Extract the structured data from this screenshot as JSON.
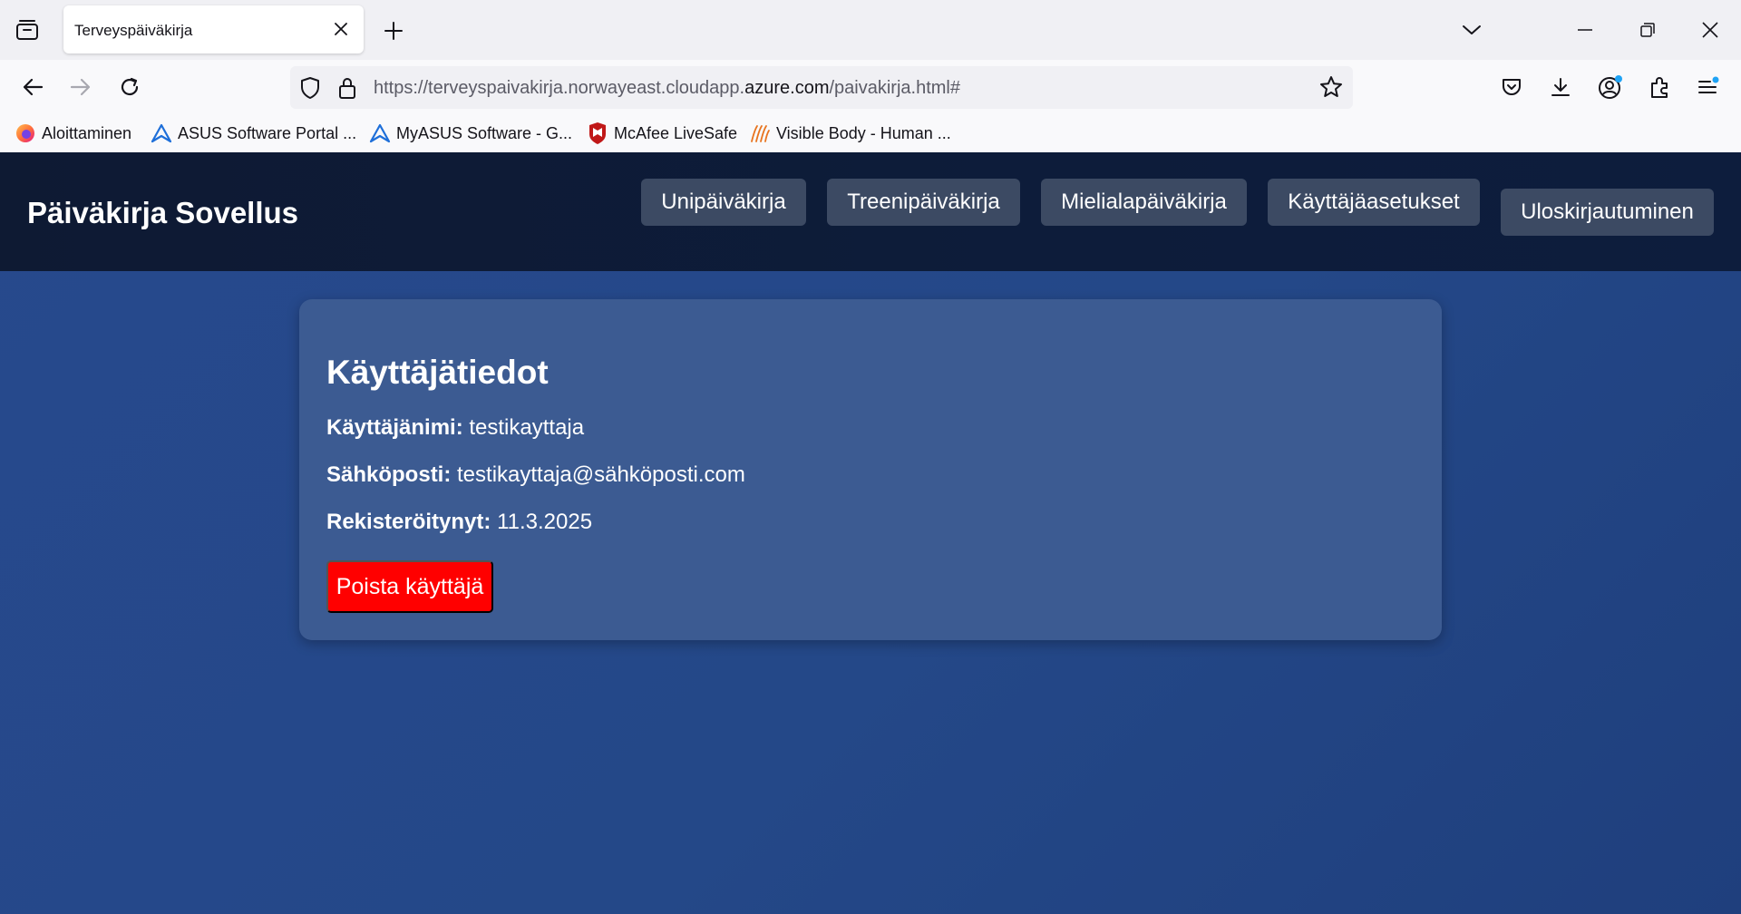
{
  "browser": {
    "tab": {
      "title": "Terveyspäiväkirja"
    },
    "url": {
      "prefix": "https://terveyspaivakirja.norwayeast.cloudapp.",
      "host": "azure.com",
      "suffix": "/paivakirja.html#"
    },
    "bookmarks": [
      {
        "label": "Aloittaminen",
        "icon": "firefox-icon"
      },
      {
        "label": "ASUS Software Portal ...",
        "icon": "asus-icon"
      },
      {
        "label": "MyASUS Software - G...",
        "icon": "asus-icon"
      },
      {
        "label": "McAfee LiveSafe",
        "icon": "mcafee-icon"
      },
      {
        "label": "Visible Body - Human ...",
        "icon": "visible-body-icon"
      }
    ],
    "colors": {
      "account_badge": "#1fa3f5"
    }
  },
  "header": {
    "title": "Päiväkirja Sovellus",
    "nav": [
      {
        "label": "Unipäiväkirja"
      },
      {
        "label": "Treenipäiväkirja"
      },
      {
        "label": "Mielialapäiväkirja"
      },
      {
        "label": "Käyttäjäasetukset"
      },
      {
        "label": "Uloskirjautuminen"
      }
    ]
  },
  "user_card": {
    "title": "Käyttäjätiedot",
    "username": {
      "label": "Käyttäjänimi:",
      "value": "testikayttaja"
    },
    "email": {
      "label": "Sähköposti:",
      "value": "testikayttaja@sähköposti.com"
    },
    "registered": {
      "label": "Rekisteröitynyt:",
      "value": "11.3.2025"
    },
    "delete_button": "Poista käyttäjä"
  },
  "colors": {
    "header_bg": "#0e1a33",
    "page_bg": "#27498d",
    "card_bg": "#3c5b92",
    "nav_button_bg": "#3c4a63",
    "danger": "#ff0000"
  }
}
